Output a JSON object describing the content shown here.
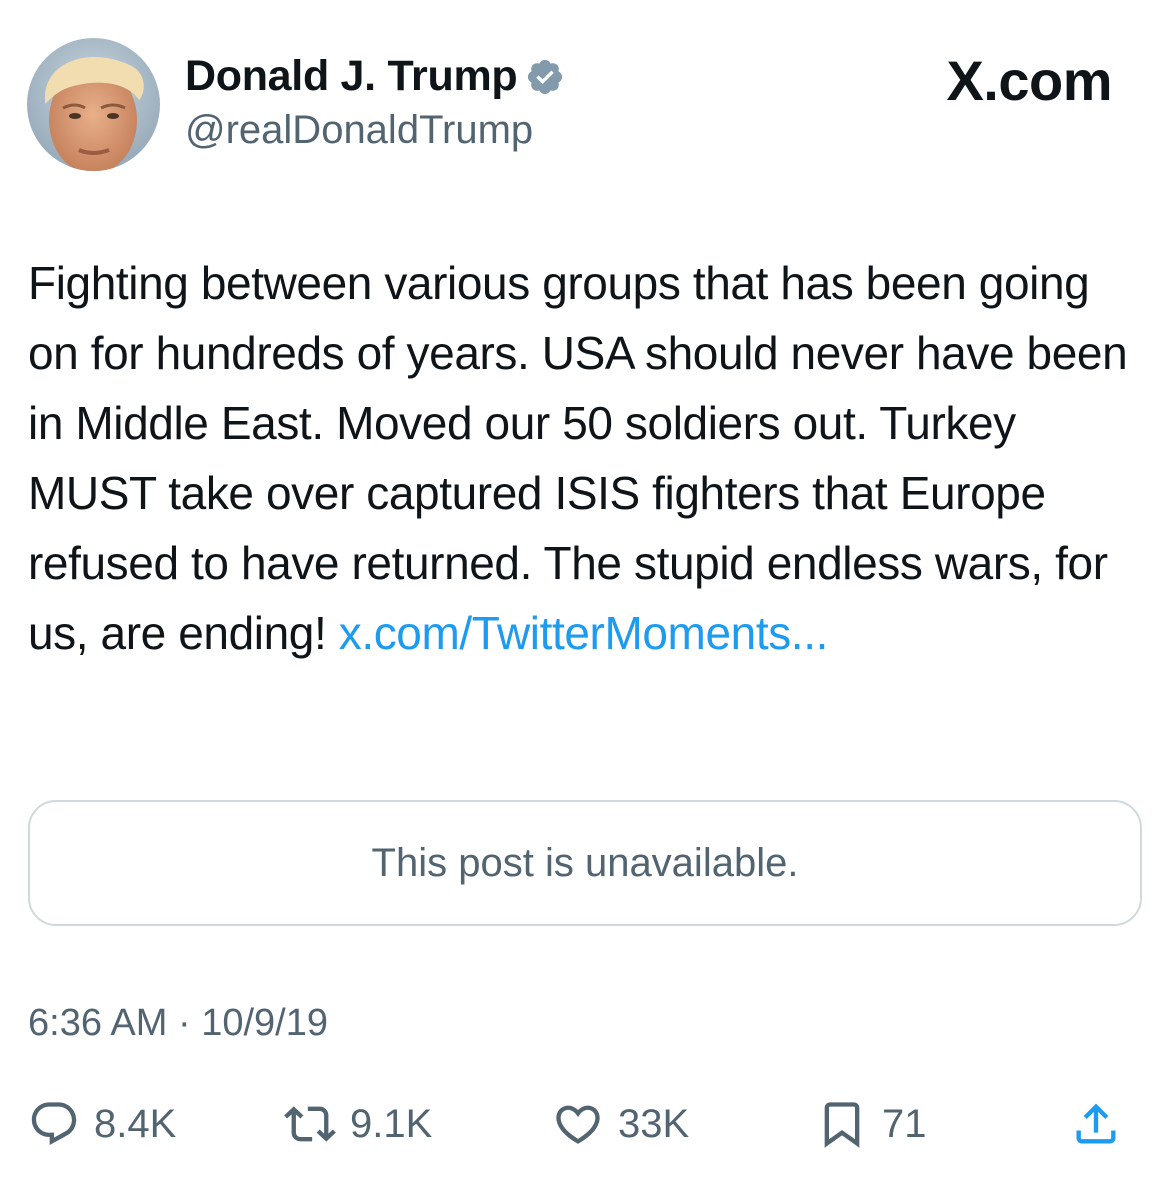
{
  "author": {
    "display_name": "Donald J. Trump",
    "handle": "@realDonaldTrump",
    "verified_color": "#829aab"
  },
  "brand": "X.com",
  "post": {
    "text": "Fighting between various groups that has been going on for hundreds of years. USA should never have been in Middle East. Moved our 50 soldiers out. Turkey MUST take over captured ISIS fighters that Europe refused to have returned. The stupid endless wars, for us, are ending!",
    "link": "x.com/TwitterMoments...",
    "link_color": "#1d9bf0"
  },
  "quote": {
    "text": "This post is unavailable."
  },
  "meta": {
    "time": "6:36 AM",
    "separator": "·",
    "date": "10/9/19"
  },
  "actions": {
    "replies": "8.4K",
    "reposts": "9.1K",
    "likes": "33K",
    "bookmarks": "71",
    "icons": [
      "reply-icon",
      "repost-icon",
      "like-icon",
      "bookmark-icon",
      "share-icon"
    ]
  }
}
